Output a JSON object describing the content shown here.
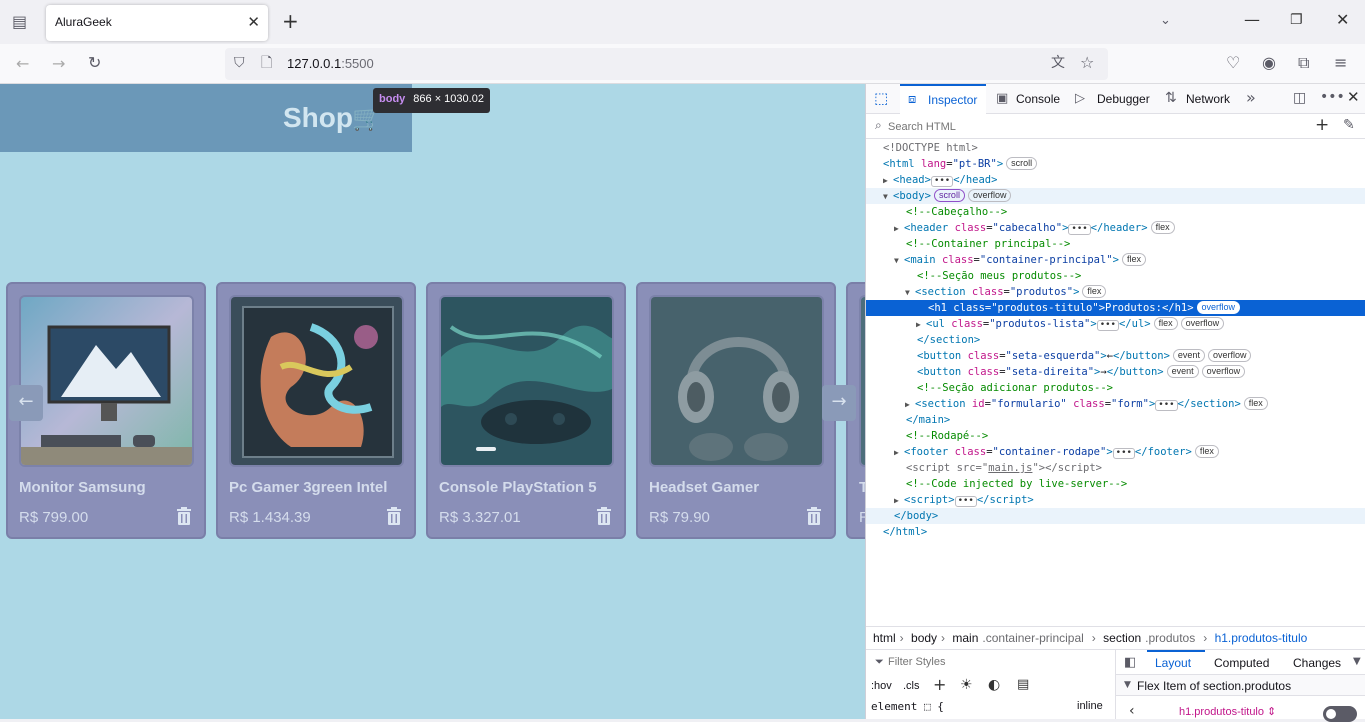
{
  "browser": {
    "tab_title": "AluraGeek",
    "tab_close": "✕",
    "new_tab": "+",
    "url_host": "127.0.0.1",
    "url_port": ":5500"
  },
  "page": {
    "shop_title": "Shop",
    "tooltip_tag": "body",
    "tooltip_size": "866 × 1030.02",
    "arrow_left": "←",
    "arrow_right": "→",
    "products": [
      {
        "name": "Monitor Samsung",
        "price": "R$ 799.00"
      },
      {
        "name": "Pc Gamer 3green Intel",
        "price": "R$ 1.434.39"
      },
      {
        "name": "Console PlayStation 5",
        "price": "R$ 3.327.01"
      },
      {
        "name": "Headset Gamer",
        "price": "R$ 79.90"
      },
      {
        "name": "T",
        "price": "R"
      }
    ]
  },
  "devtools": {
    "tabs": {
      "inspector": "Inspector",
      "console": "Console",
      "debugger": "Debugger",
      "network": "Network"
    },
    "search_placeholder": "Search HTML",
    "breadcrumbs": {
      "c0": "html",
      "c1": "body",
      "c2a": "main",
      "c2b": ".container-principal",
      "c3a": "section",
      "c3b": ".produtos",
      "c4": "h1.produtos-titulo"
    },
    "filter_placeholder": "Filter Styles",
    "hov": ":hov",
    "cls": ".cls",
    "element_rule": "element",
    "brace": "{",
    "inline_label": "inline",
    "layout_tabs": {
      "layout": "Layout",
      "computed": "Computed",
      "changes": "Changes"
    },
    "flex_item_of": "Flex Item of section.produtos",
    "flex_item_name": "h1.produtos-titulo"
  }
}
